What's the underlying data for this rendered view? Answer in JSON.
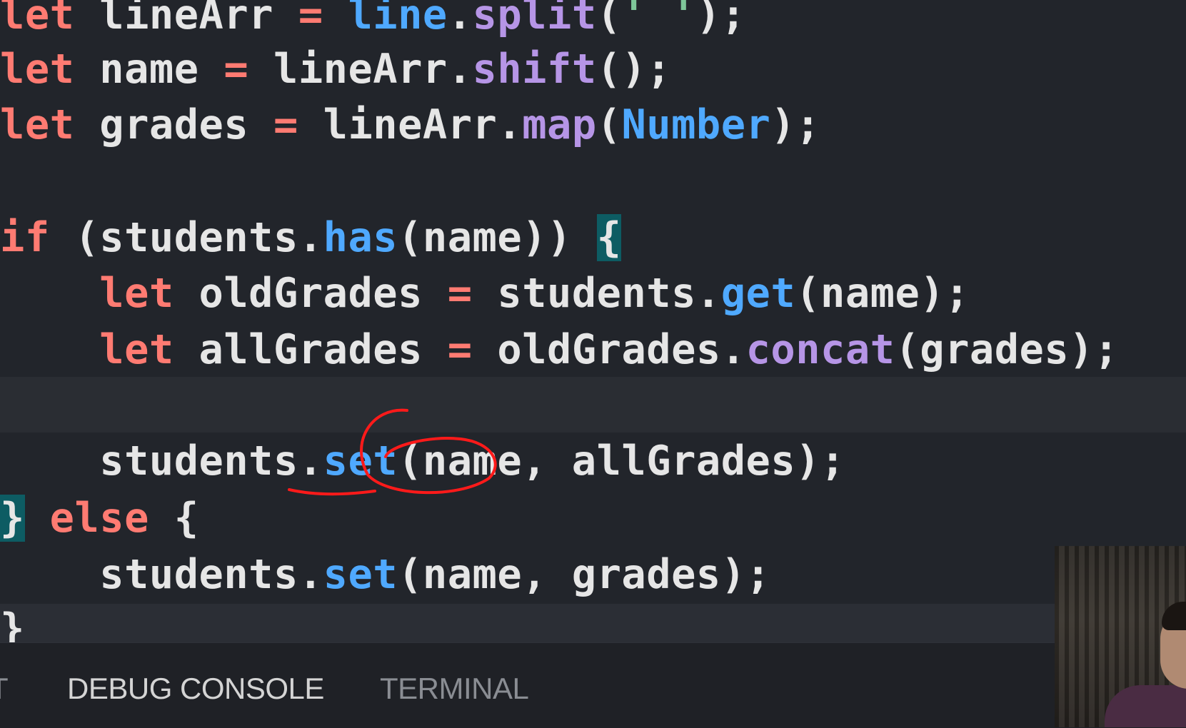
{
  "editor": {
    "lines": [
      {
        "id": "l1",
        "tokens": [
          {
            "t": "let",
            "c": "kw"
          },
          {
            "t": " lineArr "
          },
          {
            "t": "=",
            "c": "op"
          },
          {
            "t": " "
          },
          {
            "t": "line",
            "c": "const"
          },
          {
            "t": "."
          },
          {
            "t": "split",
            "c": "fn"
          },
          {
            "t": "("
          },
          {
            "t": "' '",
            "c": "str"
          },
          {
            "t": ");"
          }
        ]
      },
      {
        "id": "l2",
        "tokens": [
          {
            "t": "let",
            "c": "kw"
          },
          {
            "t": " name "
          },
          {
            "t": "=",
            "c": "op"
          },
          {
            "t": " lineArr."
          },
          {
            "t": "shift",
            "c": "fn"
          },
          {
            "t": "();"
          }
        ]
      },
      {
        "id": "l3",
        "tokens": [
          {
            "t": "let",
            "c": "kw"
          },
          {
            "t": " grades "
          },
          {
            "t": "=",
            "c": "op"
          },
          {
            "t": " lineArr."
          },
          {
            "t": "map",
            "c": "fn"
          },
          {
            "t": "("
          },
          {
            "t": "Number",
            "c": "const"
          },
          {
            "t": ");"
          }
        ]
      },
      {
        "id": "l4",
        "tokens": []
      },
      {
        "id": "l5",
        "tokens": [
          {
            "t": "if",
            "c": "kw"
          },
          {
            "t": " (students."
          },
          {
            "t": "has",
            "c": "fn-blue"
          },
          {
            "t": "(name)) "
          },
          {
            "t": "{",
            "c": "brace-hl"
          }
        ]
      },
      {
        "id": "l6",
        "tokens": [
          {
            "t": "    "
          },
          {
            "t": "let",
            "c": "kw"
          },
          {
            "t": " oldGrades "
          },
          {
            "t": "=",
            "c": "op"
          },
          {
            "t": " students."
          },
          {
            "t": "get",
            "c": "fn-blue"
          },
          {
            "t": "(name);"
          }
        ]
      },
      {
        "id": "l7",
        "tokens": [
          {
            "t": "    "
          },
          {
            "t": "let",
            "c": "kw"
          },
          {
            "t": " allGrades "
          },
          {
            "t": "=",
            "c": "op"
          },
          {
            "t": " oldGrades."
          },
          {
            "t": "concat",
            "c": "fn"
          },
          {
            "t": "(grades);"
          }
        ]
      },
      {
        "id": "l8",
        "tokens": []
      },
      {
        "id": "l9",
        "tokens": [
          {
            "t": "    students."
          },
          {
            "t": "set",
            "c": "fn-blue"
          },
          {
            "t": "(name, allGrades);"
          }
        ]
      },
      {
        "id": "l10",
        "tokens": [
          {
            "t": "}",
            "c": "brace-hl"
          },
          {
            "t": " "
          },
          {
            "t": "else",
            "c": "kw"
          },
          {
            "t": " {"
          }
        ]
      },
      {
        "id": "l11",
        "tokens": [
          {
            "t": "    students."
          },
          {
            "t": "set",
            "c": "fn-blue"
          },
          {
            "t": "(name, grades);"
          }
        ]
      },
      {
        "id": "l12",
        "tokens": [
          {
            "t": "}"
          }
        ]
      }
    ]
  },
  "panel": {
    "tabs": [
      {
        "label": "T",
        "state": "inactive"
      },
      {
        "label": "DEBUG CONSOLE",
        "state": "active"
      },
      {
        "label": "TERMINAL",
        "state": "inactive"
      }
    ]
  },
  "colors": {
    "keyword": "#ff7b72",
    "method_purple": "#b695e6",
    "method_blue": "#4fa9ff",
    "annotation_red": "#ff1a1a",
    "background": "#22252b"
  }
}
